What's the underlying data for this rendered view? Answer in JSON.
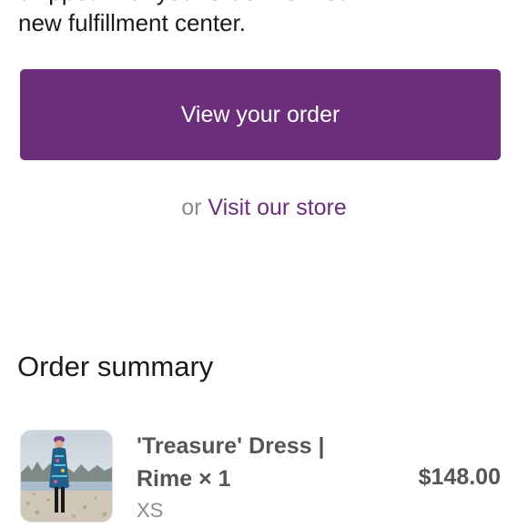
{
  "intro": {
    "line_partial": "shipped with your order from our",
    "line_last": "new fulfillment center."
  },
  "actions": {
    "primary_label": "View your order",
    "or_text": "or",
    "store_link_label": "Visit our store"
  },
  "order_summary": {
    "title": "Order summary",
    "items": [
      {
        "name": "'Treasure' Dress | Rime",
        "quantity_text": "× 1",
        "variant": "XS",
        "price": "$148.00"
      }
    ]
  },
  "colors": {
    "accent": "#6b2e7a",
    "text_primary": "#1a1a1a",
    "text_secondary": "#555555",
    "text_muted": "#8a8a8a"
  }
}
